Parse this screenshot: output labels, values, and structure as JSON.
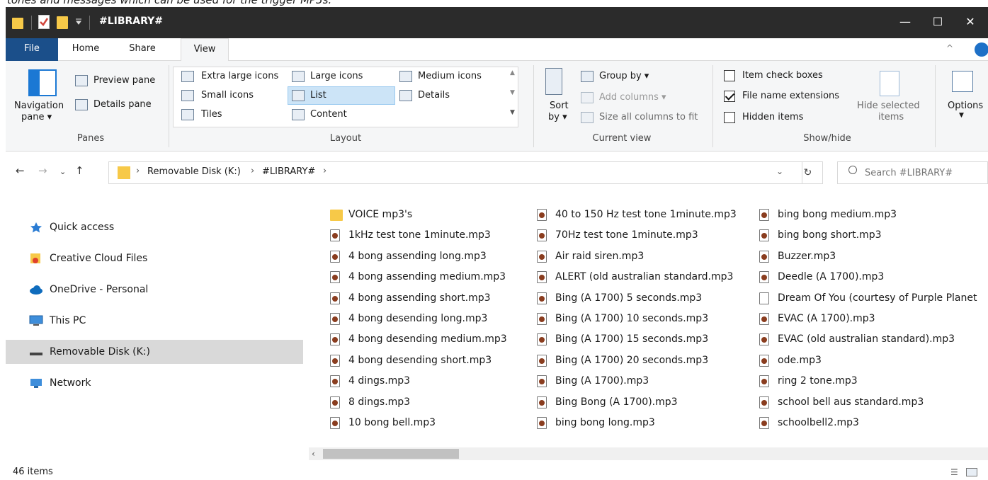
{
  "page_caption": "tones and messages which can be used for the trigger MP3s.",
  "window": {
    "title": "#LIBRARY#",
    "minimize_glyph": "—",
    "maximize_glyph": "☐",
    "close_glyph": "✕"
  },
  "tabs": [
    "File",
    "Home",
    "Share",
    "View"
  ],
  "ribbon": {
    "panes": {
      "navigation_pane": "Navigation",
      "navigation_pane_2": "pane ▾",
      "preview_pane": "Preview pane",
      "details_pane": "Details pane",
      "label": "Panes"
    },
    "layout": {
      "items": [
        "Extra large icons",
        "Large icons",
        "Medium icons",
        "Small icons",
        "List",
        "Details",
        "Tiles",
        "Content"
      ],
      "selected": "List",
      "label": "Layout"
    },
    "current_view": {
      "sort_by": "Sort",
      "sort_by_2": "by ▾",
      "group_by": "Group by ▾",
      "add_columns": "Add columns ▾",
      "size_columns": "Size all columns to fit",
      "label": "Current view"
    },
    "show_hide": {
      "item_check_boxes": "Item check boxes",
      "file_name_extensions": "File name extensions",
      "hidden_items": "Hidden items",
      "hide_selected": "Hide selected",
      "hide_selected_2": "items",
      "label": "Show/hide"
    },
    "options": "Options"
  },
  "address": {
    "crumbs": [
      "Removable Disk (K:)",
      "#LIBRARY#"
    ],
    "search_placeholder": "Search #LIBRARY#"
  },
  "nav_pane": [
    {
      "label": "Quick access",
      "icon": "star-icon"
    },
    {
      "label": "Creative Cloud Files",
      "icon": "creative-cloud-folder-icon"
    },
    {
      "label": "OneDrive - Personal",
      "icon": "cloud-icon"
    },
    {
      "label": "This PC",
      "icon": "monitor-icon"
    },
    {
      "label": "Removable Disk (K:)",
      "icon": "drive-icon",
      "selected": true
    },
    {
      "label": "Network",
      "icon": "network-icon"
    }
  ],
  "files": {
    "col1": [
      "VOICE mp3's",
      "1kHz test tone 1minute.mp3",
      "4 bong assending long.mp3",
      "4 bong assending medium.mp3",
      "4 bong assending short.mp3",
      "4 bong desending long.mp3",
      "4 bong desending medium.mp3",
      "4 bong desending short.mp3",
      "4 dings.mp3",
      "8 dings.mp3",
      "10 bong bell.mp3"
    ],
    "col2": [
      "40 to 150 Hz test tone 1minute.mp3",
      "70Hz test tone 1minute.mp3",
      "Air raid siren.mp3",
      "ALERT (old australian standard.mp3",
      "Bing (A 1700) 5 seconds.mp3",
      "Bing (A 1700) 10 seconds.mp3",
      "Bing (A 1700) 15 seconds.mp3",
      "Bing (A 1700) 20 seconds.mp3",
      "Bing (A 1700).mp3",
      "Bing Bong (A 1700).mp3",
      "bing bong long.mp3"
    ],
    "col3": [
      "bing bong medium.mp3",
      "bing bong short.mp3",
      "Buzzer.mp3",
      "Deedle (A 1700).mp3",
      "Dream Of You (courtesy of Purple Planet",
      "EVAC (A 1700).mp3",
      "EVAC (old australian standard).mp3",
      "ode.mp3",
      "ring 2 tone.mp3",
      "school bell aus standard.mp3",
      "schoolbell2.mp3"
    ]
  },
  "status": {
    "item_count": "46 items"
  },
  "colors": {
    "file_tab": "#1b4f8a",
    "selection": "#cce4f7",
    "titlebar": "#2b2b2b"
  }
}
